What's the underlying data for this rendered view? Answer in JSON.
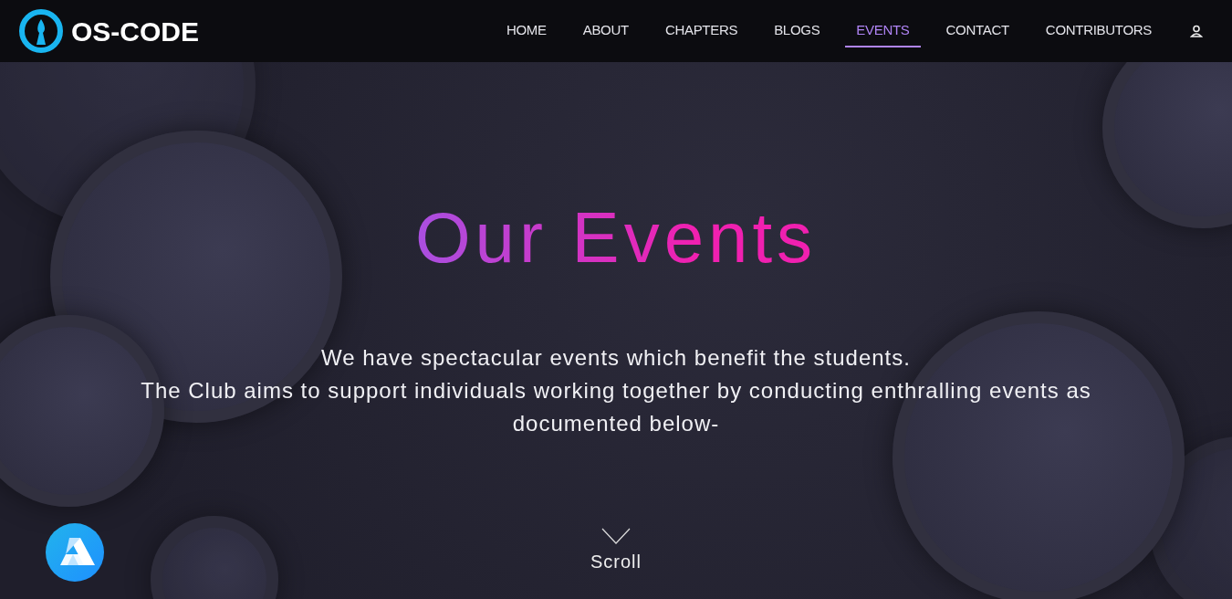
{
  "brand": {
    "name": "OS-CODE"
  },
  "nav": [
    {
      "label": "HOME",
      "selected": false
    },
    {
      "label": "ABOUT",
      "selected": false
    },
    {
      "label": "CHAPTERS",
      "selected": false
    },
    {
      "label": "BLOGS",
      "selected": false
    },
    {
      "label": "EVENTS",
      "selected": true
    },
    {
      "label": "CONTACT",
      "selected": false
    },
    {
      "label": "CONTRIBUTORS",
      "selected": false
    }
  ],
  "hero": {
    "title": "Our Events",
    "lines": [
      "We have spectacular events which benefit the students.",
      "The Club aims to support individuals working together by conducting enthralling events as documented below-"
    ]
  },
  "scroll": {
    "label": "Scroll"
  }
}
